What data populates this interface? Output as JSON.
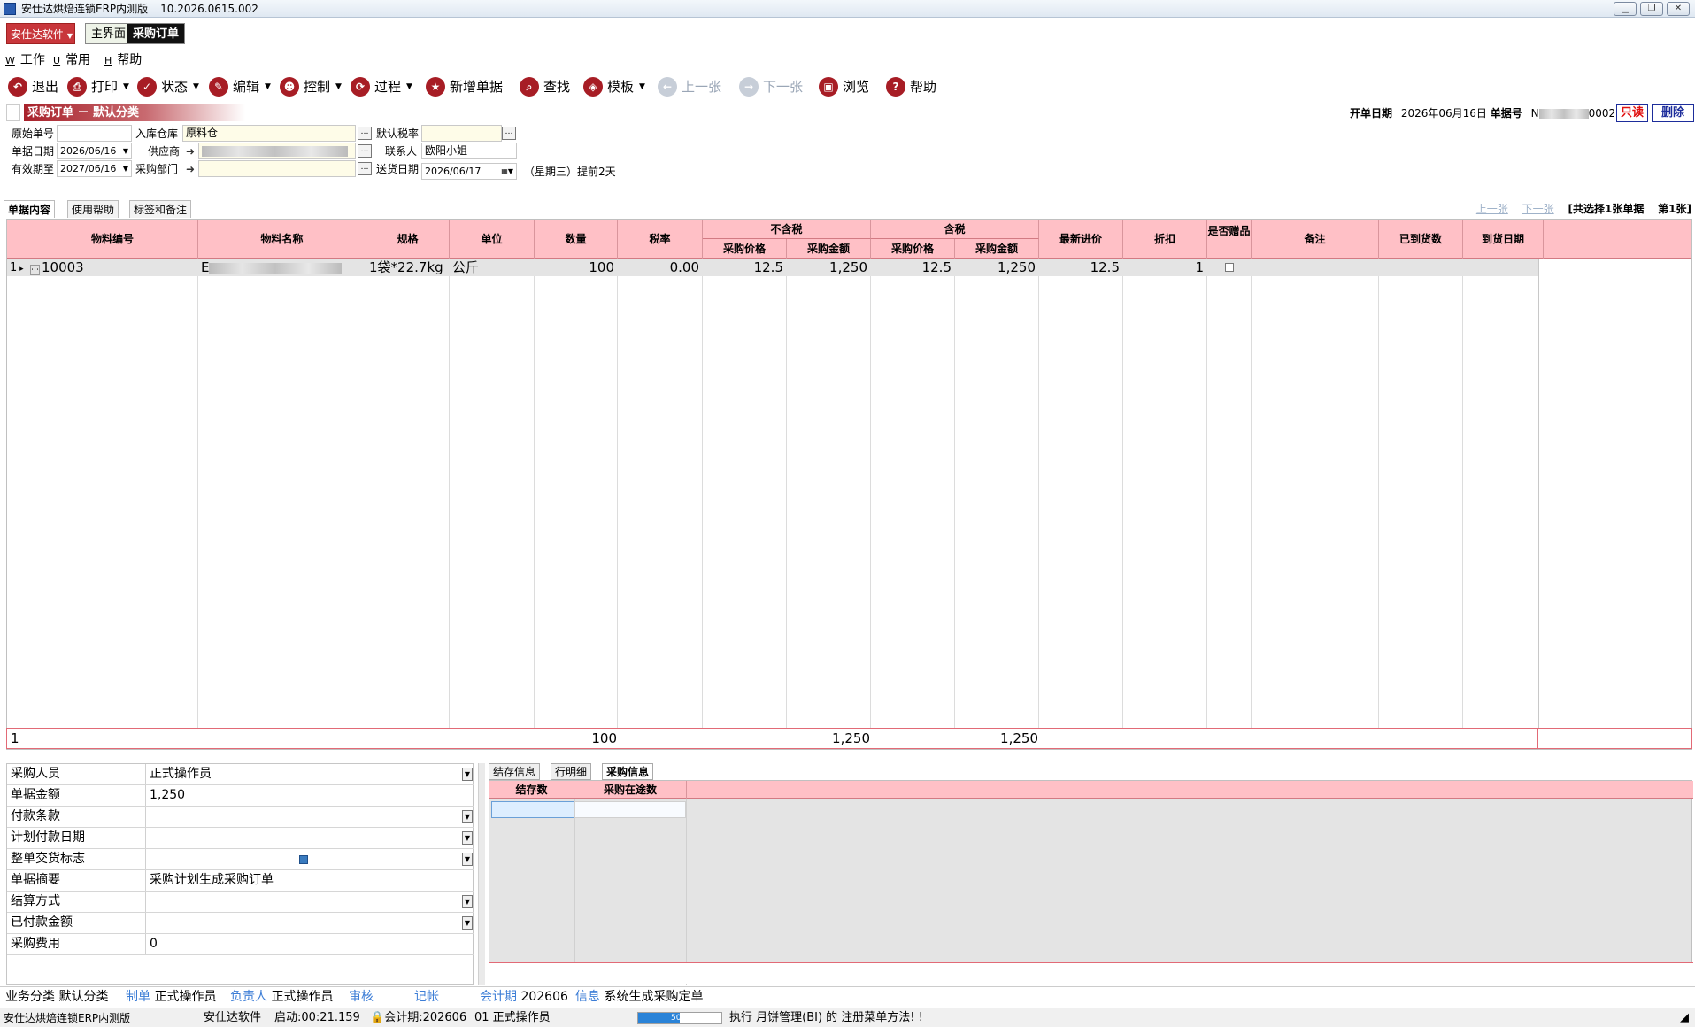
{
  "window": {
    "title": "安仕达烘焙连锁ERP内测版",
    "version": "10.2026.0615.002"
  },
  "brand": {
    "label": "安仕达软件"
  },
  "module_tabs": [
    {
      "label": "主界面"
    },
    {
      "label": "采购订单"
    }
  ],
  "menu": [
    {
      "key": "W",
      "label": "工作"
    },
    {
      "key": "U",
      "label": "常用"
    },
    {
      "key": "H",
      "label": "帮助"
    }
  ],
  "toolbar": [
    {
      "label": "退出",
      "icon": "exit-icon"
    },
    {
      "label": "打印",
      "icon": "print-icon"
    },
    {
      "label": "状态",
      "icon": "check-icon"
    },
    {
      "label": "编辑",
      "icon": "edit-icon"
    },
    {
      "label": "控制",
      "icon": "user-icon"
    },
    {
      "label": "过程",
      "icon": "cycle-icon"
    },
    {
      "label": "新增单据",
      "icon": "star-icon"
    },
    {
      "label": "查找",
      "icon": "search-icon"
    },
    {
      "label": "模板",
      "icon": "template-icon"
    },
    {
      "label": "上一张",
      "icon": "arrow-left-icon"
    },
    {
      "label": "下一张",
      "icon": "arrow-right-icon"
    },
    {
      "label": "浏览",
      "icon": "folder-icon"
    },
    {
      "label": "帮助",
      "icon": "help-icon"
    }
  ],
  "header": {
    "banner": "采购订单 － 默认分类",
    "open_date_label": "开单日期",
    "open_date": "2026年06月16日",
    "doc_no_label": "单据号",
    "doc_no_prefix": "N",
    "doc_no_suffix": "0002",
    "readonly_badge": "只读",
    "delete_badge": "删除"
  },
  "form": {
    "orig_no_label": "原始单号",
    "orig_no": "",
    "warehouse_label": "入库仓库",
    "warehouse": "原料仓",
    "tax_label": "默认税率",
    "tax": "",
    "doc_date_label": "单据日期",
    "doc_date": "2026/06/16",
    "supplier_label": "供应商",
    "contact_label": "联系人",
    "contact": "欧阳小姐",
    "valid_label": "有效期至",
    "valid_date": "2027/06/16",
    "dept_label": "采购部门",
    "dept": "",
    "delivery_label": "送货日期",
    "delivery_date": "2026/06/17",
    "delivery_note": "（星期三）提前2天"
  },
  "subtabs": [
    {
      "label": "单据内容"
    },
    {
      "label": "使用帮助"
    },
    {
      "label": "标签和备注"
    }
  ],
  "pager": {
    "prev": "上一张",
    "next": "下一张",
    "summary": "[共选择1张单据",
    "page": "第1张]"
  },
  "grid": {
    "columns": {
      "material_code": "物料编号",
      "material_name": "物料名称",
      "spec": "规格",
      "unit": "单位",
      "qty": "数量",
      "tax_rate": "税率",
      "group_ex_tax": "不含税",
      "group_inc_tax": "含税",
      "price": "采购价格",
      "amount": "采购金额",
      "latest_price": "最新进价",
      "discount": "折扣",
      "gift": "是否赠品",
      "note": "备注",
      "arrived": "已到货数",
      "arrival_date": "到货日期"
    },
    "rows": [
      {
        "no": "1",
        "material_code": "10003",
        "material_name": "E",
        "spec": "1袋*22.7kg",
        "unit": "公斤",
        "qty": "100",
        "tax_rate": "0.00",
        "price_ex": "12.5",
        "amount_ex": "1,250",
        "price_inc": "12.5",
        "amount_inc": "1,250",
        "latest_price": "12.5",
        "discount": "1",
        "gift": false,
        "note": "",
        "arrived": "",
        "arrival_date": ""
      }
    ],
    "totals": {
      "count": "1",
      "qty": "100",
      "amount_ex": "1,250",
      "amount_inc": "1,250"
    }
  },
  "props": [
    {
      "label": "采购人员",
      "value": "正式操作员",
      "dropdown": true
    },
    {
      "label": "单据金额",
      "value": "1,250",
      "dropdown": false
    },
    {
      "label": "付款条款",
      "value": "",
      "dropdown": true
    },
    {
      "label": "计划付款日期",
      "value": "",
      "dropdown": true
    },
    {
      "label": "整单交货标志",
      "value": "",
      "dropdown": true
    },
    {
      "label": "单据摘要",
      "value": "采购计划生成采购订单",
      "dropdown": false
    },
    {
      "label": "结算方式",
      "value": "",
      "dropdown": true
    },
    {
      "label": "已付款金额",
      "value": "",
      "dropdown": true
    },
    {
      "label": "采购费用",
      "value": "0",
      "dropdown": false
    }
  ],
  "bottom_tabs": [
    {
      "label": "结存信息"
    },
    {
      "label": "行明细"
    },
    {
      "label": "采购信息"
    }
  ],
  "bottom_grid": {
    "columns": [
      "结存数",
      "采购在途数"
    ]
  },
  "status1": [
    {
      "label": "业务分类",
      "value": "默认分类"
    },
    {
      "label": "制单",
      "value": "正式操作员"
    },
    {
      "label": "负责人",
      "value": "正式操作员"
    },
    {
      "label": "审核",
      "value": ""
    },
    {
      "label": "记帐",
      "value": ""
    },
    {
      "label": "会计期",
      "value": "202606"
    },
    {
      "label": "信息",
      "value": "系统生成采购定单"
    }
  ],
  "status2": {
    "app": "安仕达烘焙连锁ERP内测版",
    "company": "安仕达软件",
    "uptime": "启动:00:21.159",
    "period": "会计期:202606",
    "operator": "01 正式操作员",
    "progress": 50,
    "progress_text": "50%",
    "message": "执行 月饼管理(BI) 的 注册菜单方法! !"
  },
  "colors": {
    "brand_red": "#c8363b",
    "grid_header": "#ffc0c6",
    "link_blue": "#3c7dd6",
    "progress_blue": "#2a83d8"
  }
}
